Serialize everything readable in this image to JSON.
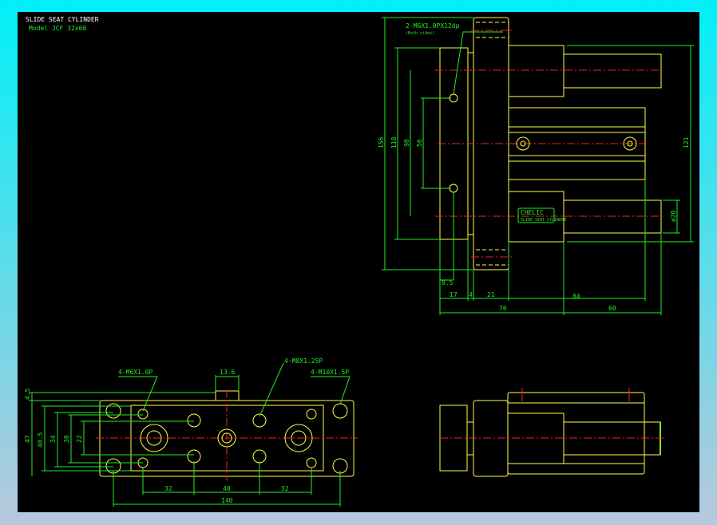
{
  "title": {
    "name": "SLIDE SEAT CYLINDER",
    "model": "Model JCF 32x60"
  },
  "colors": {
    "background": "#000000",
    "outline": "#ffff44",
    "dimension": "#22ee22",
    "centerline": "#ee2222",
    "frame": "#00f0f8"
  },
  "side_view": {
    "leader_label": "2-M6X1.0PX12dp",
    "leader_note": "(Both sides)",
    "nameplate": {
      "brand": "CHELIC",
      "line": "SLIDE SEAT CYLINDER"
    },
    "dims": {
      "d156": "156",
      "d118": "118",
      "d90": "90",
      "d56": "56",
      "d121": "121",
      "d20": "ø20",
      "d8_5": "8.5",
      "d17": "17",
      "d4": "4",
      "d21": "21",
      "d84": "84",
      "d76": "76",
      "d60": "60"
    }
  },
  "bottom_view": {
    "labels": {
      "m6": "4-M6X1.0P",
      "m8": "4-M8X1.25P",
      "m10": "4-M10X1.5P"
    },
    "dims": {
      "d13_6": "13.6",
      "d4_5": "4.5",
      "d47": "47",
      "d40_5": "40.5",
      "d34": "34",
      "d30": "30",
      "d22": "22",
      "d32a": "32",
      "d40": "40",
      "d32b": "32",
      "d140": "140"
    }
  }
}
